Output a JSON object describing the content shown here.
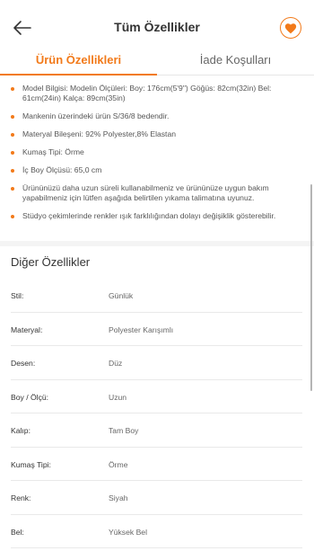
{
  "header": {
    "title": "Tüm Özellikler"
  },
  "tabs": [
    {
      "label": "Ürün Özellikleri"
    },
    {
      "label": "İade Koşulları"
    }
  ],
  "bullets": [
    "Model Bilgisi: Modelin Ölçüleri: Boy: 176cm(5'9\") Göğüs: 82cm(32in) Bel: 61cm(24in) Kalça: 89cm(35in)",
    "Mankenin üzerindeki ürün S/36/8 bedendir.",
    "Materyal Bileşeni: 92% Polyester,8% Elastan",
    "Kumaş Tipi: Örme",
    "İç Boy Ölçüsü: 65,0 cm",
    "Ürününüzü daha uzun süreli kullanabilmeniz ve ürününüze uygun bakım yapabilmeniz için lütfen aşağıda belirtilen yıkama talimatına uyunuz.",
    "Stüdyo çekimlerinde renkler ışık farklılığından dolayı değişiklik gösterebilir."
  ],
  "other": {
    "title": "Diğer Özellikler",
    "rows": [
      {
        "key": "Stil:",
        "value": "Günlük"
      },
      {
        "key": "Materyal:",
        "value": "Polyester Karışımlı"
      },
      {
        "key": "Desen:",
        "value": "Düz"
      },
      {
        "key": "Boy / Ölçü:",
        "value": "Uzun"
      },
      {
        "key": "Kalıp:",
        "value": "Tam Boy"
      },
      {
        "key": "Kumaş Tipi:",
        "value": "Örme"
      },
      {
        "key": "Renk:",
        "value": "Siyah"
      },
      {
        "key": "Bel:",
        "value": "Yüksek Bel"
      }
    ]
  },
  "colors": {
    "accent": "#f27a1a"
  },
  "icons": {
    "back": "arrow-left-icon",
    "favorite": "heart-icon"
  }
}
